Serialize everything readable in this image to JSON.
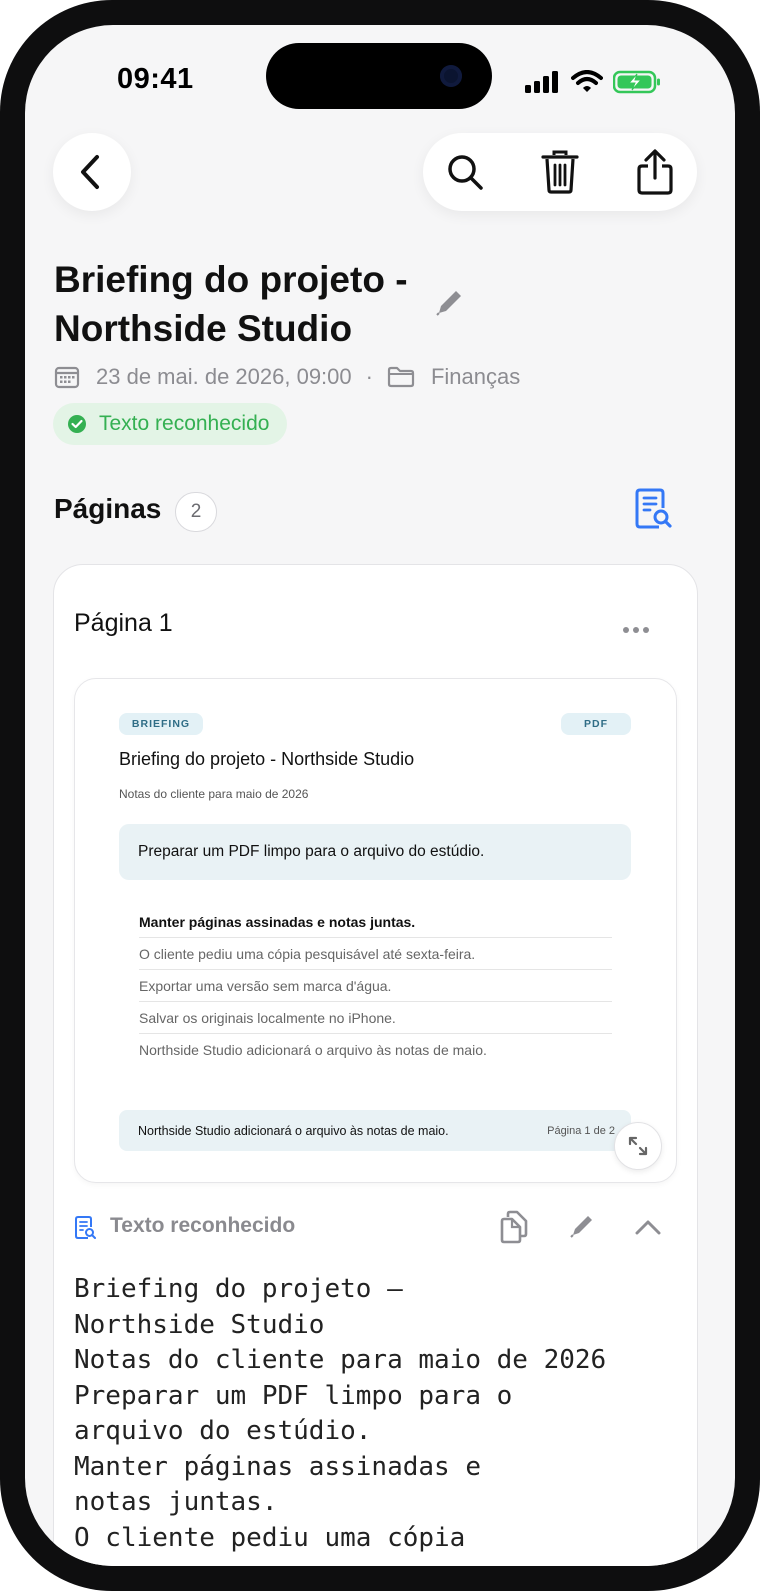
{
  "status_bar": {
    "time": "09:41"
  },
  "header": {
    "title": "Briefing do projeto - Northside Studio",
    "date": "23 de mai. de 2026, 09:00",
    "separator": "·",
    "folder": "Finanças",
    "badge": "Texto reconhecido"
  },
  "pages": {
    "label": "Páginas",
    "count": "2"
  },
  "page_card": {
    "title": "Página 1",
    "preview": {
      "tag_left": "BRIEFING",
      "tag_right": "PDF",
      "title": "Briefing do projeto - Northside Studio",
      "subtitle": "Notas do cliente para maio de 2026",
      "highlight": "Preparar um PDF limpo para o arquivo do estúdio.",
      "list": [
        "Manter páginas assinadas e notas juntas.",
        "O cliente pediu uma cópia pesquisável até sexta-feira.",
        "Exportar uma versão sem marca d'água.",
        "Salvar os originais localmente no iPhone.",
        "Northside Studio adicionará o arquivo às notas de maio."
      ],
      "footer_text": "Northside Studio adicionará o arquivo às notas de maio.",
      "footer_page": "Página 1 de 2"
    },
    "ocr_label": "Texto reconhecido",
    "ocr_text": "Briefing do projeto –\nNorthside Studio\nNotas do cliente para maio de 2026\nPreparar um PDF limpo para o\narquivo do estúdio.\nManter páginas assinadas e\nnotas juntas.\nO cliente pediu uma cópia"
  },
  "colors": {
    "accent": "#3478f6",
    "success": "#34b052",
    "badge_bg": "#e3f4e6"
  },
  "icons": [
    "back-chevron-icon",
    "search-icon",
    "trash-icon",
    "share-icon",
    "pencil-icon",
    "calendar-icon",
    "folder-icon",
    "check-circle-icon",
    "document-search-icon",
    "more-icon",
    "expand-icon",
    "copy-icon",
    "chevron-up-icon"
  ]
}
